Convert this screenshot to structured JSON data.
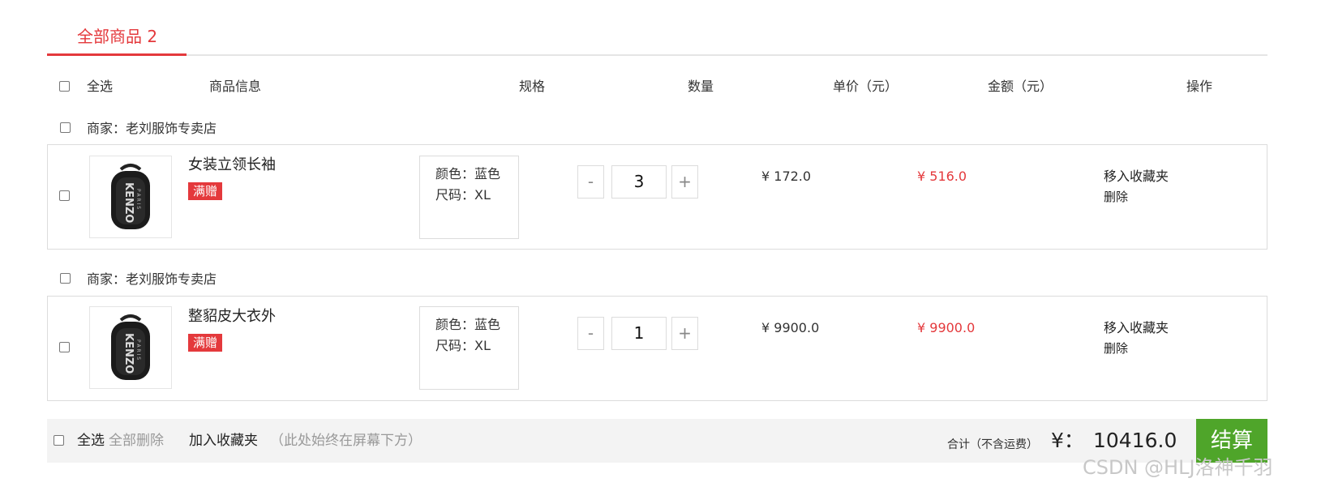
{
  "tab": {
    "label": "全部商品 2"
  },
  "header": {
    "select_all": "全选",
    "product_info": "商品信息",
    "spec": "规格",
    "quantity": "数量",
    "unit_price": "单价（元）",
    "amount": "金额（元）",
    "actions": "操作"
  },
  "groups": [
    {
      "merchant": "商家：老刘服饰专卖店",
      "item": {
        "name": "女装立领长袖",
        "tag": "满赠",
        "color": "颜色：蓝色",
        "size": "尺码：XL",
        "minus": "-",
        "qty": "3",
        "plus": "+",
        "price": "¥ 172.0",
        "amount": "¥ 516.0",
        "move_fav": "移入收藏夹",
        "delete": "删除"
      }
    },
    {
      "merchant": "商家：老刘服饰专卖店",
      "item": {
        "name": "整貂皮大衣外",
        "tag": "满赠",
        "color": "颜色：蓝色",
        "size": "尺码：XL",
        "minus": "-",
        "qty": "1",
        "plus": "+",
        "price": "¥ 9900.0",
        "amount": "¥ 9900.0",
        "move_fav": "移入收藏夹",
        "delete": "删除"
      }
    }
  ],
  "footer": {
    "select_all": "全选",
    "delete_all": "全部删除",
    "add_fav": "加入收藏夹",
    "note": "（此处始终在屏幕下方）",
    "total_label": "合计（不含运费）",
    "currency": "¥：",
    "total": "10416.0",
    "checkout": "结算"
  },
  "watermark": "CSDN @HLJ洛神千羽",
  "colors": {
    "accent": "#e4393c",
    "checkout": "#4fa52a"
  }
}
